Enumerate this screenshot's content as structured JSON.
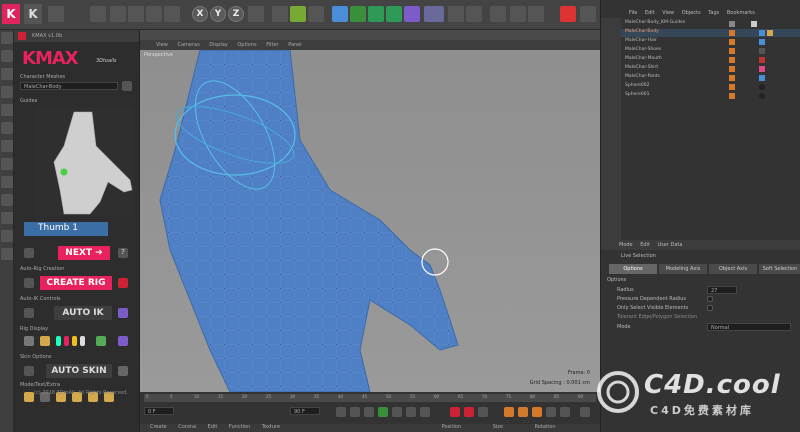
{
  "app": {
    "window_title": "KMAX v1.0b",
    "brand_color": "#e8225c"
  },
  "toolbar": {
    "axis_x": "X",
    "axis_y": "Y",
    "axis_z": "Z"
  },
  "kmax": {
    "logo": "KMAX",
    "subtitle": "3Dtoalls",
    "character_meshes_label": "Character Meshes",
    "character_mesh_value": "MaleChar-Body",
    "guides_label": "Guides",
    "thumb_label": "Thumb 1",
    "next_button": "NEXT ➔",
    "help_label": "?",
    "auto_rig_label": "Auto-Rig Creation",
    "create_rig_button": "CREATE RIG",
    "auto_ik_label": "Auto-IK Controls",
    "auto_ik_button": "AUTO IK",
    "rig_display_label": "Rig Display",
    "skin_options_label": "Skin Options",
    "auto_skin_button": "AUTO SKIN",
    "mode_label": "Mode/Test/Extra",
    "copyright": "(c) 2018 3DtoAll. All Rights Reserved."
  },
  "viewport": {
    "menu": [
      "View",
      "Cameras",
      "Display",
      "Options",
      "Filter",
      "Panel"
    ],
    "label": "Perspective",
    "frame_info": "Frame: 0",
    "grid_info": "Grid Spacing : 0.001 cm"
  },
  "timeline": {
    "ticks": [
      "0",
      "5",
      "10",
      "15",
      "20",
      "25",
      "30",
      "35",
      "40",
      "45",
      "50",
      "55",
      "60",
      "65",
      "70",
      "75",
      "80",
      "85",
      "90"
    ],
    "start_frame": "0 F",
    "end_frame": "90 F",
    "current_frame": "0 F"
  },
  "bottom_menu": [
    "Create",
    "Corona",
    "Edit",
    "Function",
    "Texture"
  ],
  "bottom_right": [
    "Position",
    "Size",
    "Rotation"
  ],
  "objects": {
    "menu": [
      "File",
      "Edit",
      "View",
      "Objects",
      "Tags",
      "Bookmarks"
    ],
    "rows": [
      {
        "name": "MaleChar-Body_KM-Guides",
        "selected": false
      },
      {
        "name": "MaleChar-Body",
        "selected": true
      },
      {
        "name": "MaleChar-Hair",
        "selected": false
      },
      {
        "name": "MaleChar-Shoes",
        "selected": false
      },
      {
        "name": "MaleChar-Mouth",
        "selected": false
      },
      {
        "name": "MaleChar-Shirt",
        "selected": false
      },
      {
        "name": "MaleChar-Pants",
        "selected": false
      },
      {
        "name": "Sphere002",
        "selected": false
      },
      {
        "name": "Sphere001",
        "selected": false
      }
    ]
  },
  "attributes": {
    "menu": [
      "Mode",
      "Edit",
      "User Data"
    ],
    "tool_name": "Live Selection",
    "tabs": [
      "Options",
      "Modeling Axis",
      "Object Axis",
      "Soft Selection"
    ],
    "section": "Options",
    "radius_label": "Radius",
    "radius_value": "27",
    "pressure_label": "Pressure Dependent Radius",
    "only_visible_label": "Only Select Visible Elements",
    "tolerant_label": "Tolerant Edge/Polygon Selection",
    "mode_label": "Mode",
    "mode_value": "Normal"
  },
  "watermark": {
    "text": "C4D.cool",
    "subtext": "C4D免费素材库"
  }
}
